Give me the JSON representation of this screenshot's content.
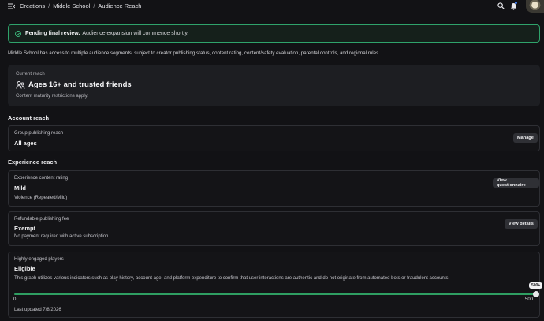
{
  "breadcrumb": [
    "Creations",
    "Middle School",
    "Audience Reach"
  ],
  "banner": {
    "bold": "Pending final review.",
    "text": "Audience expansion will commence shortly."
  },
  "description": "Middle School has access to multiple audience segments, subject to creator publishing status, content rating, content/safety evaluation, parental controls, and regional rules.",
  "current_reach": {
    "label": "Current reach",
    "title": "Ages 16+ and trusted friends",
    "subtitle": "Content maturity restrictions apply."
  },
  "account_reach": {
    "heading": "Account reach",
    "card": {
      "label": "Group publishing reach",
      "value": "All ages",
      "button": "Manage"
    }
  },
  "experience_reach": {
    "heading": "Experience reach",
    "rating": {
      "label": "Experience content rating",
      "value": "Mild",
      "note": "Violence (Repeated/Mild)",
      "button": "View questionnaire"
    },
    "fee": {
      "label": "Refundable publishing fee",
      "value": "Exempt",
      "note": "No payment required with active subscription.",
      "button": "View details"
    },
    "players": {
      "label": "Highly engaged players",
      "value": "Eligible",
      "note": "This graph utilizes various indicators such as play history, account age, and platform expenditure to confirm that user interactions are authentic and do not originate from automated bots or fraudulent accounts.",
      "slider_min": "0",
      "slider_max": "500",
      "slider_tip": "500+",
      "slider_fraction": 1.0,
      "updated": "Last updated 7/8/2026"
    }
  },
  "colors": {
    "accent_green": "#2fa36b",
    "notification_blue": "#3f7cf0"
  },
  "icons": [
    "menu-icon",
    "search-icon",
    "bell-icon",
    "check-circle-icon",
    "people-icon"
  ]
}
